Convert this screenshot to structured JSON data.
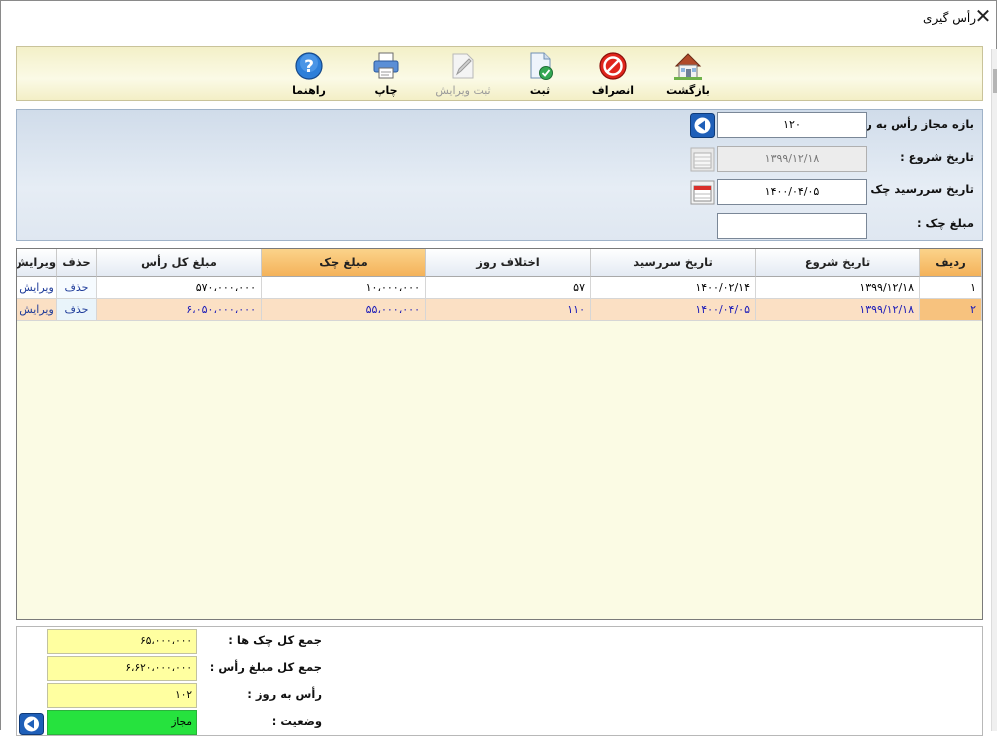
{
  "window": {
    "title": "رأس گیری",
    "close_glyph": "✕"
  },
  "toolbar": {
    "buttons": [
      {
        "id": "back",
        "label": "بازگشت",
        "icon": "house-icon",
        "enabled": true
      },
      {
        "id": "cancel",
        "label": "انصراف",
        "icon": "no-entry-icon",
        "enabled": true
      },
      {
        "id": "save",
        "label": "ثبت",
        "icon": "document-check-icon",
        "enabled": true
      },
      {
        "id": "save_edit",
        "label": "ثبت ویرایش",
        "icon": "pencil-icon",
        "enabled": false
      },
      {
        "id": "print",
        "label": "چاپ",
        "icon": "printer-icon",
        "enabled": true
      },
      {
        "id": "help",
        "label": "راهنما",
        "icon": "help-icon",
        "enabled": true
      }
    ]
  },
  "params": {
    "allowed_days_label": "بازه مجاز رأس به روز :",
    "allowed_days_value": "۱۲۰",
    "start_date_label": "تاریخ شروع :",
    "start_date_value": "۱۳۹۹/۱۲/۱۸",
    "due_date_label": "تاریخ سررسید چک :",
    "due_date_value": "۱۴۰۰/۰۴/۰۵",
    "check_amount_label": "مبلغ چک :",
    "check_amount_value": ""
  },
  "grid": {
    "columns": [
      "ردیف",
      "تاریخ شروع",
      "تاریخ سررسید",
      "اختلاف روز",
      "مبلغ چک",
      "مبلغ کل رأس",
      "حذف",
      "ویرایش"
    ],
    "rows": [
      {
        "row": "۱",
        "start": "۱۳۹۹/۱۲/۱۸",
        "due": "۱۴۰۰/۰۲/۱۴",
        "diff": "۵۷",
        "amount": "۱۰،۰۰۰،۰۰۰",
        "total": "۵۷۰،۰۰۰،۰۰۰",
        "delete": "حذف",
        "edit": "ویرایش"
      },
      {
        "row": "۲",
        "start": "۱۳۹۹/۱۲/۱۸",
        "due": "۱۴۰۰/۰۴/۰۵",
        "diff": "۱۱۰",
        "amount": "۵۵،۰۰۰،۰۰۰",
        "total": "۶،۰۵۰،۰۰۰،۰۰۰",
        "delete": "حذف",
        "edit": "ویرایش"
      }
    ]
  },
  "summary": {
    "total_checks_label": "جمع کل چک ها :",
    "total_checks_value": "۶۵،۰۰۰،۰۰۰",
    "total_amount_label": "جمع کل مبلغ رأس :",
    "total_amount_value": "۶،۶۲۰،۰۰۰،۰۰۰",
    "days_label": "رأس به روز :",
    "days_value": "۱۰۲",
    "status_label": "وضعیت :",
    "status_value": "مجاز"
  },
  "colors": {
    "status_ok": "#26e23e",
    "selected_row": "#fbe0c4",
    "toolbar_bg": "#f3f0c8",
    "params_bg": "#d0dcea",
    "grid_bg": "#fbfbe4"
  }
}
